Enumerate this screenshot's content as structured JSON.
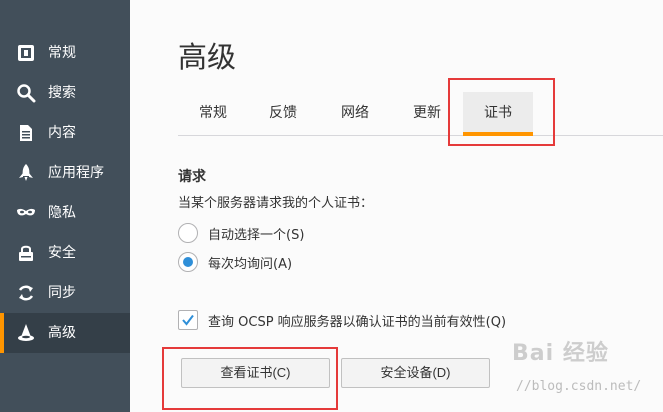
{
  "sidebar": {
    "items": [
      {
        "label": "常规",
        "icon": "general-icon"
      },
      {
        "label": "搜索",
        "icon": "search-icon"
      },
      {
        "label": "内容",
        "icon": "content-icon"
      },
      {
        "label": "应用程序",
        "icon": "rocket-icon"
      },
      {
        "label": "隐私",
        "icon": "mask-icon"
      },
      {
        "label": "安全",
        "icon": "lock-icon"
      },
      {
        "label": "同步",
        "icon": "sync-icon"
      },
      {
        "label": "高级",
        "icon": "wizard-hat-icon"
      }
    ],
    "active_index": 7
  },
  "page_title": "高级",
  "tabs": [
    {
      "label": "常规"
    },
    {
      "label": "反馈"
    },
    {
      "label": "网络"
    },
    {
      "label": "更新"
    },
    {
      "label": "证书"
    }
  ],
  "selected_tab_index": 4,
  "certificates": {
    "section_title": "请求",
    "description": "当某个服务器请求我的个人证书：",
    "radio_auto": "自动选择一个(S)",
    "radio_ask": "每次均询问(A)",
    "selected_radio": "ask",
    "ocsp_label": "查询 OCSP 响应服务器以确认证书的当前有效性(Q)",
    "ocsp_checked": true,
    "view_button": "查看证书(C)",
    "devices_button": "安全设备(D)"
  },
  "watermark": {
    "logo": "Bai 经验",
    "url": "//blog.csdn.net/"
  },
  "colors": {
    "sidebar_bg": "#424f5a",
    "sidebar_active_bg": "#343f48",
    "accent": "#ff9500",
    "highlight": "#e53a3a",
    "radio_checked": "#2f8fd8"
  }
}
